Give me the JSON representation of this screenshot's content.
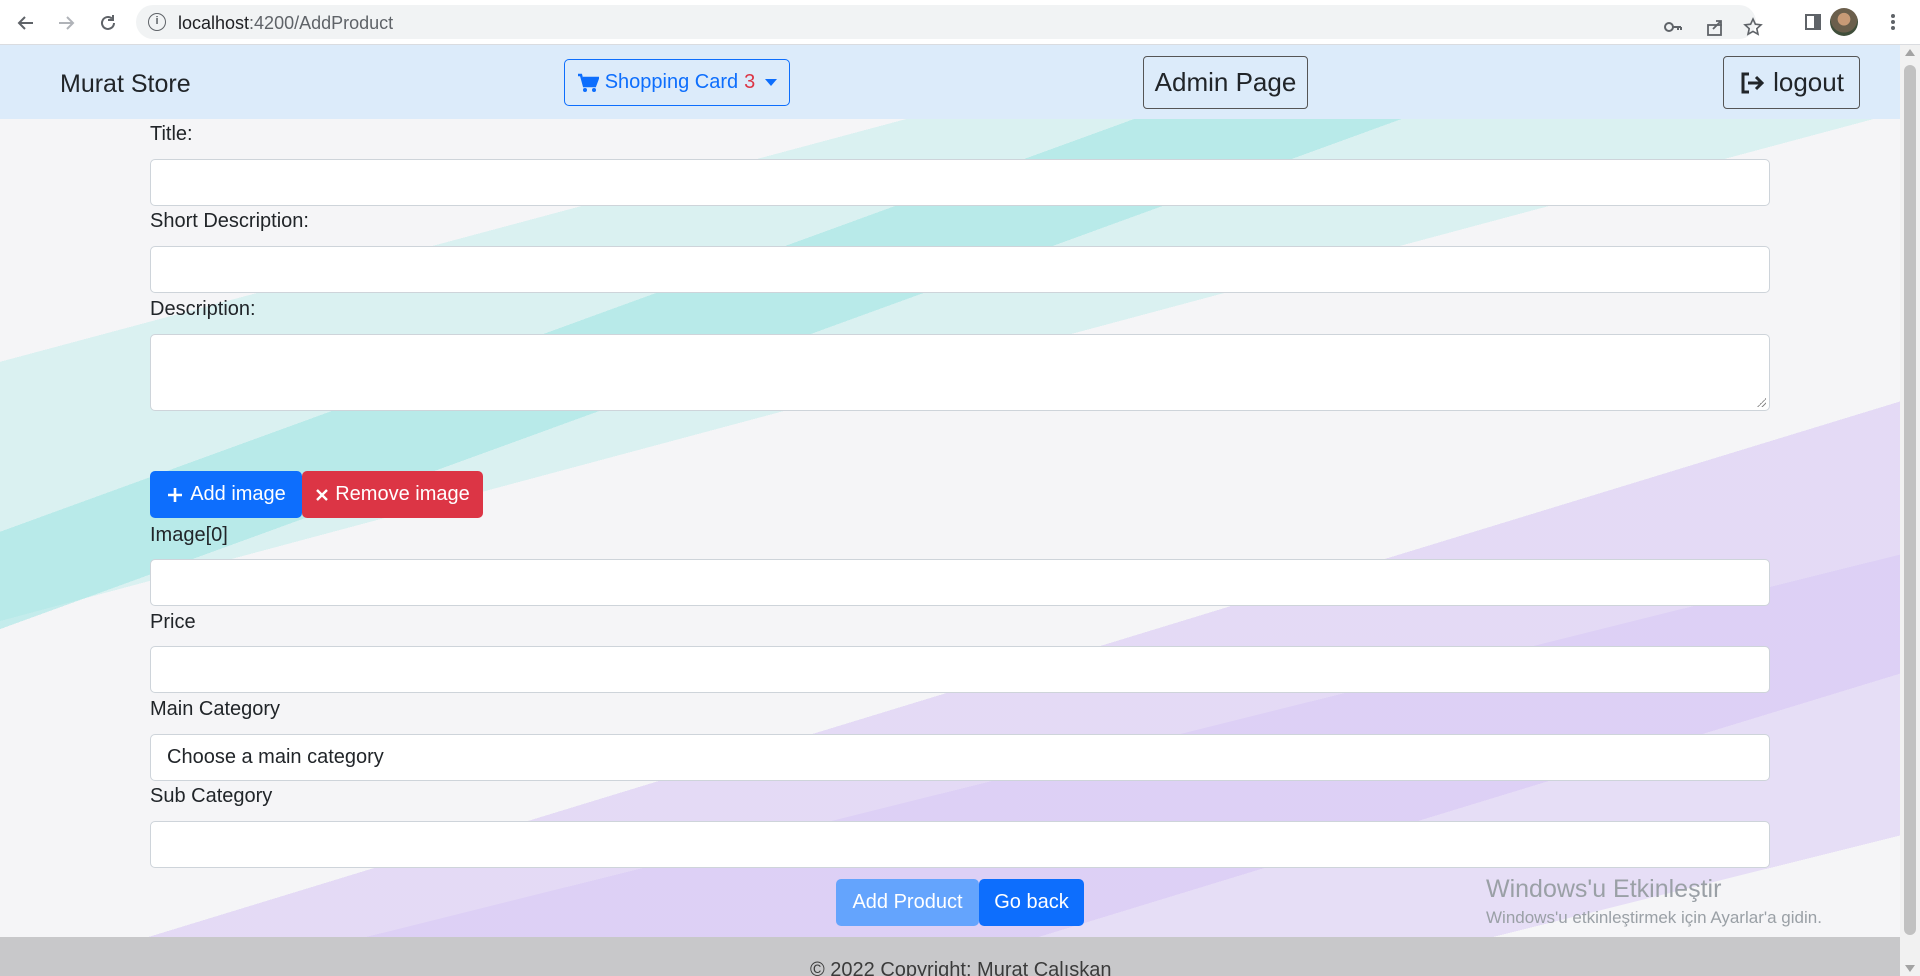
{
  "browser": {
    "url_host": "localhost",
    "url_path": ":4200/AddProduct"
  },
  "navbar": {
    "brand": "Murat Store",
    "cart_label": "Shopping Card",
    "cart_count": "3",
    "admin_label": "Admin Page",
    "logout_label": "logout"
  },
  "form": {
    "title_label": "Title:",
    "short_desc_label": "Short Description:",
    "desc_label": "Description:",
    "add_image_label": "Add image",
    "remove_image_label": "Remove image",
    "image_label": "Image[0]",
    "price_label": "Price",
    "main_category_label": "Main Category",
    "main_category_value": "Choose a main category",
    "sub_category_label": "Sub Category",
    "add_product_label": "Add Product",
    "go_back_label": "Go back"
  },
  "watermark": {
    "title": "Windows'u Etkinleştir",
    "subtitle": "Windows'u etkinleştirmek için Ayarlar'a gidin."
  },
  "footer": {
    "copyright": "© 2022 Copyright: Murat Calıskan"
  },
  "colors": {
    "primary": "#0d6efd",
    "danger": "#dc3545",
    "navbar_bg": "#dcebfa"
  }
}
